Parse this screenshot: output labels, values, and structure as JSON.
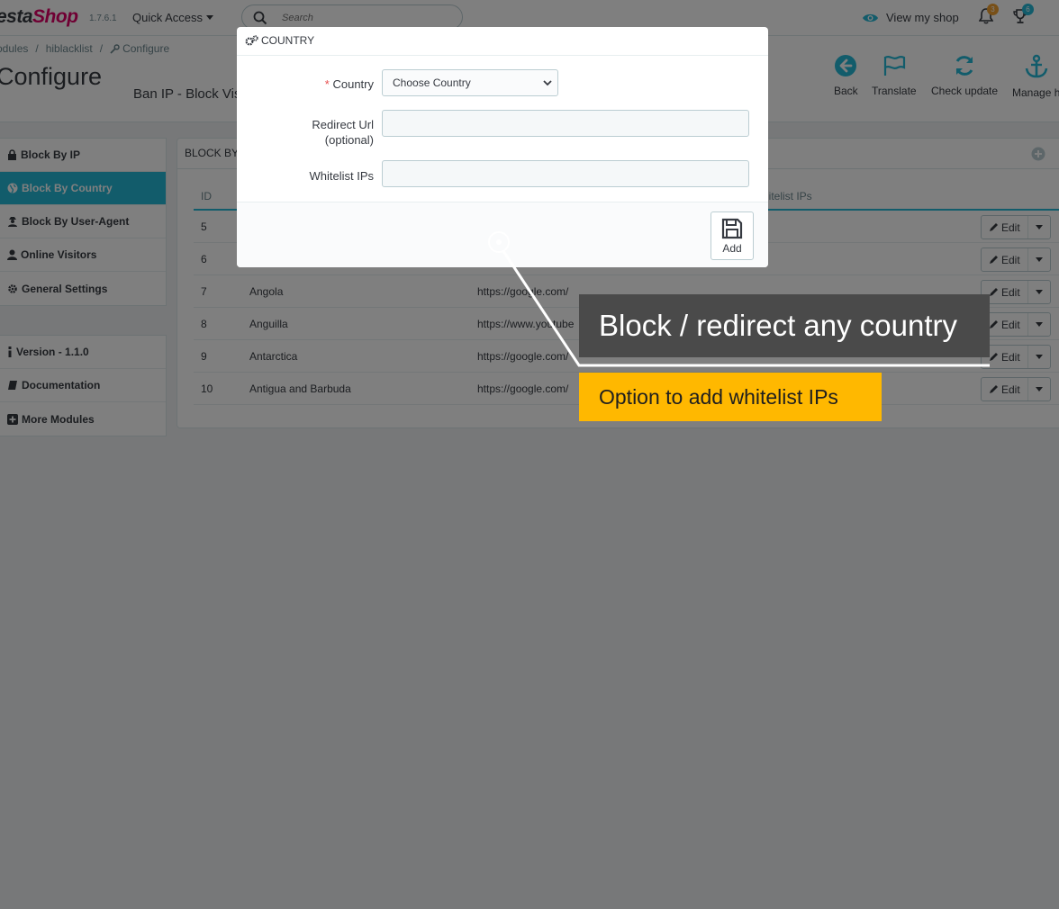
{
  "header": {
    "logo_part1": "esta",
    "logo_part2": "Shop",
    "version": "1.7.6.1",
    "quick_access_label": "Quick Access",
    "search_placeholder": "Search",
    "view_shop_label": "View my shop",
    "notifications_count": "3",
    "achievements_count": "6"
  },
  "breadcrumb": {
    "items": [
      "odules",
      "hiblacklist",
      "Configure"
    ],
    "separator": "/"
  },
  "page": {
    "title": "Configure",
    "module_name": "Ban IP - Block Vis"
  },
  "toolbar": {
    "back_label": "Back",
    "translate_label": "Translate",
    "check_update_label": "Check update",
    "manage_label": "Manage h"
  },
  "sidebar": {
    "items": [
      {
        "label": "Block By IP",
        "icon": "lock-icon",
        "active": false
      },
      {
        "label": "Block By Country",
        "icon": "globe-icon",
        "active": true
      },
      {
        "label": "Block By User-Agent",
        "icon": "user-secret-icon",
        "active": false
      },
      {
        "label": "Online Visitors",
        "icon": "user-icon",
        "active": false
      },
      {
        "label": "General Settings",
        "icon": "gear-icon",
        "active": false
      }
    ],
    "info_items": [
      {
        "label": "Version - 1.1.0",
        "icon": "info-icon"
      },
      {
        "label": "Documentation",
        "icon": "book-icon"
      },
      {
        "label": "More Modules",
        "icon": "plus-square-icon"
      }
    ]
  },
  "list": {
    "title": "BLOCK BY C",
    "columns": {
      "id": "ID",
      "whitelist": "hitelist IPs"
    },
    "edit_label": "Edit",
    "rows": [
      {
        "id": "5",
        "country": "",
        "url": ""
      },
      {
        "id": "6",
        "country": "",
        "url": ""
      },
      {
        "id": "7",
        "country": "Angola",
        "url": "https://google.com/"
      },
      {
        "id": "8",
        "country": "Anguilla",
        "url": "https://www.youtube"
      },
      {
        "id": "9",
        "country": "Antarctica",
        "url": "https://google.com/"
      },
      {
        "id": "10",
        "country": "Antigua and Barbuda",
        "url": "https://google.com/"
      }
    ]
  },
  "modal": {
    "title": "COUNTRY",
    "country_label": "Country",
    "required_mark": "*",
    "country_select_value": "Choose Country",
    "redirect_label_line1": "Redirect Url",
    "redirect_label_line2": "(optional)",
    "redirect_value": "",
    "whitelist_label": "Whitelist IPs",
    "whitelist_value": "",
    "add_label": "Add"
  },
  "callouts": {
    "main": "Block / redirect any country",
    "sub": "Option to add whitelist IPs"
  },
  "colors": {
    "accent": "#25b9d7",
    "brand": "#df0067",
    "callout_dark": "#4a4a4a",
    "callout_yellow": "#ffb800"
  }
}
